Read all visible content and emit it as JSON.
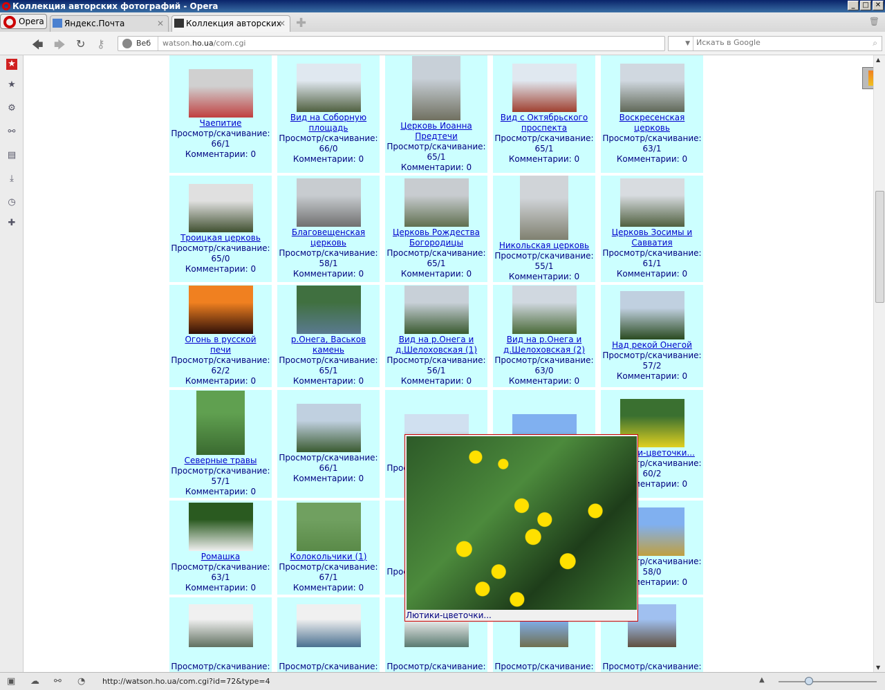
{
  "window": {
    "title": "Коллекция авторских фотографий - Opera"
  },
  "tabs": {
    "opera_menu": "Opera",
    "items": [
      {
        "label": "Яндекс.Почта"
      },
      {
        "label": "Коллекция авторских ..."
      }
    ]
  },
  "nav": {
    "addr_prefix": "Веб",
    "url_host": "watson.",
    "url_domain": "ho.ua",
    "url_path": "/com.cgi",
    "search_placeholder": "Искать в Google"
  },
  "status": {
    "url": "http://watson.ho.ua/com.cgi?id=72&type=4"
  },
  "labels": {
    "views": "Просмотр/скачивание:",
    "comments": "Комментарии: 0"
  },
  "popup": {
    "caption": "Лютики-цветочки..."
  },
  "cells": [
    {
      "title": "Чаепитие",
      "stats": "66/1",
      "orient": "landscape",
      "colors": [
        "#d0d0d0",
        "#c04040"
      ]
    },
    {
      "title": "Вид на Соборную площадь",
      "stats": "66/0",
      "orient": "landscape",
      "colors": [
        "#e0e8f0",
        "#506040"
      ]
    },
    {
      "title": "Церковь Иоанна Предтечи",
      "stats": "65/1",
      "orient": "portrait",
      "colors": [
        "#c8d0d8",
        "#707060"
      ]
    },
    {
      "title": "Вид с Октябрьского проспекта",
      "stats": "65/1",
      "orient": "landscape",
      "colors": [
        "#e0e8f0",
        "#a04030"
      ]
    },
    {
      "title": "Воскресенская церковь",
      "stats": "63/1",
      "orient": "landscape",
      "colors": [
        "#d0d8e0",
        "#606858"
      ]
    },
    {
      "title": "Троицкая церковь",
      "stats": "65/0",
      "orient": "landscape",
      "colors": [
        "#e0e0e0",
        "#405030"
      ]
    },
    {
      "title": "Благовещенская церковь",
      "stats": "58/1",
      "orient": "landscape",
      "colors": [
        "#c8ccd0",
        "#707070"
      ]
    },
    {
      "title": "Церковь Рождества Богородицы",
      "stats": "65/1",
      "orient": "landscape",
      "colors": [
        "#c8ccd0",
        "#607050"
      ]
    },
    {
      "title": "Никольская церковь",
      "stats": "55/1",
      "orient": "portrait",
      "colors": [
        "#d0d4d8",
        "#808070"
      ]
    },
    {
      "title": "Церковь Зосимы и Савватия",
      "stats": "61/1",
      "orient": "landscape",
      "colors": [
        "#d8dce0",
        "#506040"
      ]
    },
    {
      "title": "Огонь в русской печи",
      "stats": "62/2",
      "orient": "landscape",
      "colors": [
        "#f08020",
        "#301008"
      ]
    },
    {
      "title": "р.Онега, Васьков камень",
      "stats": "65/1",
      "orient": "landscape",
      "colors": [
        "#407040",
        "#5a7a90"
      ]
    },
    {
      "title": "Вид на р.Онега и д.Шелоховская (1)",
      "stats": "56/1",
      "orient": "landscape",
      "colors": [
        "#c8d0d8",
        "#3a5a30"
      ]
    },
    {
      "title": "Вид на р.Онега и д.Шелоховская (2)",
      "stats": "63/0",
      "orient": "landscape",
      "colors": [
        "#d0d8e0",
        "#4a6a38"
      ]
    },
    {
      "title": "Над рекой Онегой",
      "stats": "57/2",
      "orient": "landscape",
      "colors": [
        "#c0d0e0",
        "#2a4a20"
      ]
    },
    {
      "title": "Северные травы",
      "stats": "57/1",
      "orient": "portrait",
      "colors": [
        "#60a050",
        "#3a6a30"
      ]
    },
    {
      "title": "",
      "stats": "66/1",
      "orient": "landscape",
      "colors": [
        "#c0d0e0",
        "#3a5a30"
      ]
    },
    {
      "title": "",
      "stats": "",
      "orient": "landscape",
      "colors": [
        "#d0e0f0",
        "#506040"
      ]
    },
    {
      "title": "",
      "stats": "",
      "orient": "landscape",
      "colors": [
        "#80b0f0",
        "#4a7a38"
      ]
    },
    {
      "title": "Лютики-цветочки...",
      "stats": "60/2",
      "orient": "landscape",
      "colors": [
        "#3a7030",
        "#e0d020"
      ]
    },
    {
      "title": "Ромашка",
      "stats": "63/1",
      "orient": "landscape",
      "colors": [
        "#2a5a20",
        "#f0f0f0"
      ]
    },
    {
      "title": "Колокольчики (1)",
      "stats": "67/1",
      "orient": "landscape",
      "colors": [
        "#70a060",
        "#5a8a48"
      ]
    },
    {
      "title": "",
      "stats": "",
      "orient": "landscape",
      "colors": [
        "#ccffff",
        "#ccffff"
      ]
    },
    {
      "title": "",
      "stats": "",
      "orient": "landscape",
      "colors": [
        "#ccffff",
        "#ccffff"
      ]
    },
    {
      "title": "",
      "stats": "58/0",
      "orient": "landscape",
      "colors": [
        "#80b0f0",
        "#c0a040"
      ]
    },
    {
      "title": "",
      "stats": "",
      "orient": "landscape",
      "colors": [
        "#f0f0f0",
        "#607060"
      ]
    },
    {
      "title": "",
      "stats": "",
      "orient": "landscape",
      "colors": [
        "#f0f0f0",
        "#4a7090"
      ]
    },
    {
      "title": "",
      "stats": "",
      "orient": "landscape",
      "colors": [
        "#f0f0f0",
        "#5a7a70"
      ]
    },
    {
      "title": "",
      "stats": "",
      "orient": "portrait",
      "colors": [
        "#80b0f0",
        "#707050"
      ]
    },
    {
      "title": "",
      "stats": "",
      "orient": "portrait",
      "colors": [
        "#a0c0f0",
        "#605040"
      ]
    }
  ]
}
